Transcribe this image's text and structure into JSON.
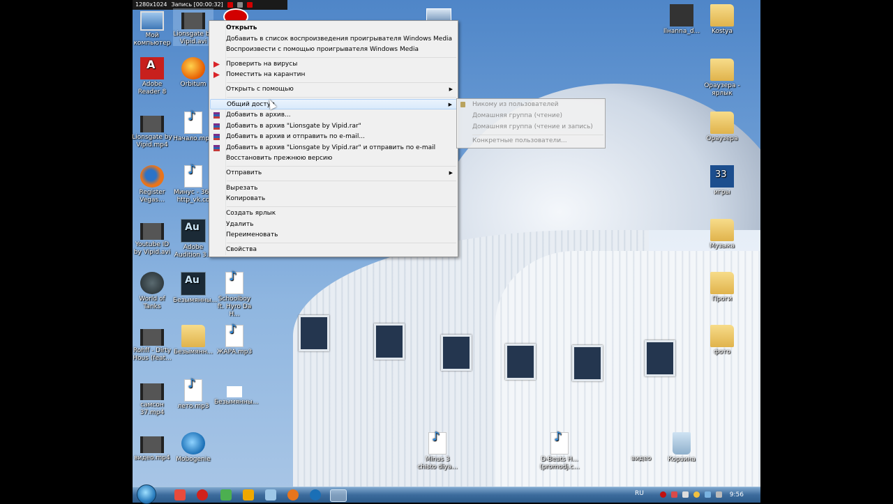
{
  "recorder": {
    "resolution": "1280x1024",
    "status": "Запись [00:00:32]"
  },
  "desktop": {
    "icons": [
      {
        "id": "my-computer",
        "label": "Мой компьютер",
        "type": "pc"
      },
      {
        "id": "lionsgate-avi",
        "label": "Lionsgate by Vipid.avi",
        "type": "video"
      },
      {
        "id": "adobe-reader",
        "label": "Adobe Reader 8",
        "type": "red"
      },
      {
        "id": "orbitum",
        "label": "Orbitum",
        "type": "orb"
      },
      {
        "id": "lionsgate-mp4",
        "label": "Lionsgate by Vipid.mp4",
        "type": "video"
      },
      {
        "id": "nachalo",
        "label": "Начало.mp3",
        "type": "mp3"
      },
      {
        "id": "register-vegas",
        "label": "Register Vegas...",
        "type": "fox"
      },
      {
        "id": "minus",
        "label": "Минус - 364 http_vk.co",
        "type": "mp3"
      },
      {
        "id": "youtube-id",
        "label": "Youtube ID by Vipid.avi",
        "type": "video"
      },
      {
        "id": "adobe-audition",
        "label": "Adobe Audition 3.0",
        "type": "au"
      },
      {
        "id": "world-of-tanks",
        "label": "World of Tanks",
        "type": "tank"
      },
      {
        "id": "bezymyanny-ses",
        "label": "Безымянны...",
        "type": "au"
      },
      {
        "id": "schoolboy",
        "label": "Schoolboy ft. Hyro Da H...",
        "type": "mp3"
      },
      {
        "id": "rohff",
        "label": "Rohff - Dirty Hous (feat...",
        "type": "video"
      },
      {
        "id": "bezymyanny-folder",
        "label": "Безымянн...",
        "type": "folder"
      },
      {
        "id": "zhara",
        "label": "ЖАРА.mp3",
        "type": "mp3"
      },
      {
        "id": "samson",
        "label": "самсон 37.mp4",
        "type": "video"
      },
      {
        "id": "leto",
        "label": "лето.mp3",
        "type": "mp3"
      },
      {
        "id": "bezymyanny-txt",
        "label": "Безымянны...",
        "type": "mp3"
      },
      {
        "id": "video-mp4",
        "label": "видео.mp4",
        "type": "video"
      },
      {
        "id": "mobogenie",
        "label": "Mobogenie",
        "type": "mobo"
      },
      {
        "id": "minus3",
        "label": "Minus 3 chisto diya...",
        "type": "mp3"
      },
      {
        "id": "d-beats",
        "label": "D-Beats H... (promodj.c...",
        "type": "mp3"
      },
      {
        "id": "video",
        "label": "видео",
        "type": "none"
      },
      {
        "id": "korzina",
        "label": "Корзина",
        "type": "bin"
      },
      {
        "id": "ilnanna",
        "label": "Ilнanna_d...",
        "type": "video"
      },
      {
        "id": "kostya",
        "label": "Kostya",
        "type": "folder"
      },
      {
        "id": "orauzera-yarlyk",
        "label": "Ораузера - ярлык",
        "type": "folder"
      },
      {
        "id": "orauzera",
        "label": "Ораузера",
        "type": "folder"
      },
      {
        "id": "igry",
        "label": "игры",
        "type": "blue33"
      },
      {
        "id": "muzyka",
        "label": "Музыка",
        "type": "folder"
      },
      {
        "id": "progi",
        "label": "Проги",
        "type": "folder"
      },
      {
        "id": "foto",
        "label": "фото",
        "type": "folder"
      }
    ]
  },
  "context_menu": {
    "open": "Открыть",
    "add_playlist": "Добавить в список воспроизведения проигрывателя Windows Media",
    "play_wmp": "Воспроизвести с помощью проигрывателя Windows Media",
    "scan_virus": "Проверить на вирусы",
    "quarantine": "Поместить на карантин",
    "open_with": "Открыть с помощью",
    "share": "Общий доступ",
    "add_archive": "Добавить в архив...",
    "add_rar": "Добавить в архив \"Lionsgate by Vipid.rar\"",
    "add_email": "Добавить в архив и отправить по e-mail...",
    "add_rar_email": "Добавить в архив \"Lionsgate by Vipid.rar\" и отправить по e-mail",
    "restore": "Восстановить прежнюю версию",
    "send_to": "Отправить",
    "cut": "Вырезать",
    "copy": "Копировать",
    "shortcut": "Создать ярлык",
    "delete": "Удалить",
    "rename": "Переименовать",
    "properties": "Свойства"
  },
  "share_submenu": {
    "nobody": "Никому из пользователей",
    "homegroup_read": "Домашняя группа (чтение)",
    "homegroup_rw": "Домашняя группа (чтение и запись)",
    "specific": "Конкретные пользователи..."
  },
  "taskbar": {
    "lang": "RU",
    "time": "9:56"
  }
}
